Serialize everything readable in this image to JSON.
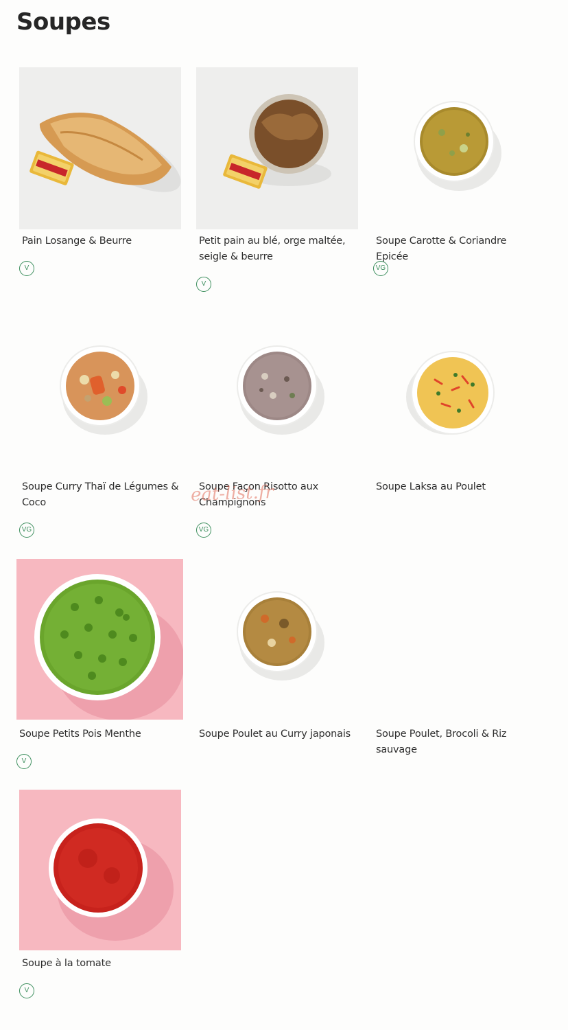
{
  "page": {
    "title": "Soupes"
  },
  "watermark": "eat-list.fr",
  "colors": {
    "badge": "#3d8f5e",
    "pink_bg": "#f7b8c0"
  },
  "products": [
    {
      "name": "Pain Losange & Beurre",
      "badge": "V"
    },
    {
      "name": "Petit pain au blé, orge maltée, seigle & beurre",
      "badge": "V"
    },
    {
      "name": "Soupe Carotte & Coriandre Epicée",
      "badge": "VG"
    },
    {
      "name": "Soupe Curry Thaï de Légumes & Coco",
      "badge": "VG"
    },
    {
      "name": "Soupe Façon Risotto aux Champignons",
      "badge": "VG"
    },
    {
      "name": "Soupe Laksa au Poulet",
      "badge": ""
    },
    {
      "name": "Soupe Petits Pois Menthe",
      "badge": "V"
    },
    {
      "name": "Soupe Poulet au Curry japonais",
      "badge": ""
    },
    {
      "name": "Soupe Poulet, Brocoli & Riz sauvage",
      "badge": ""
    },
    {
      "name": "Soupe à la tomate",
      "badge": "V"
    }
  ]
}
